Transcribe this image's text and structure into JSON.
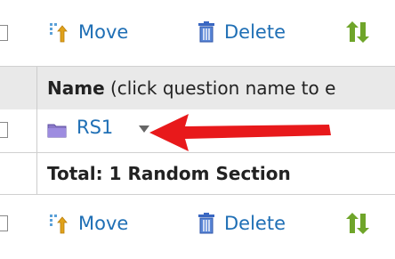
{
  "toolbar_top": {
    "move_label": "Move",
    "delete_label": "Delete"
  },
  "table": {
    "header_bold": "Name",
    "header_rest": " (click question name to e",
    "row": {
      "name": "RS1"
    },
    "total": "Total:  1 Random Section"
  },
  "toolbar_bottom": {
    "move_label": "Move",
    "delete_label": "Delete"
  },
  "icons": {
    "move": "move-icon",
    "delete": "trash-icon",
    "sort": "sort-icon",
    "folder": "folder-icon",
    "menu": "caret-down-icon",
    "annotation": "red-arrow"
  },
  "colors": {
    "link": "#1f6fb5",
    "header_bg": "#e9e9e9",
    "arrow": "#e8191b",
    "folder": "#8a78c8"
  }
}
